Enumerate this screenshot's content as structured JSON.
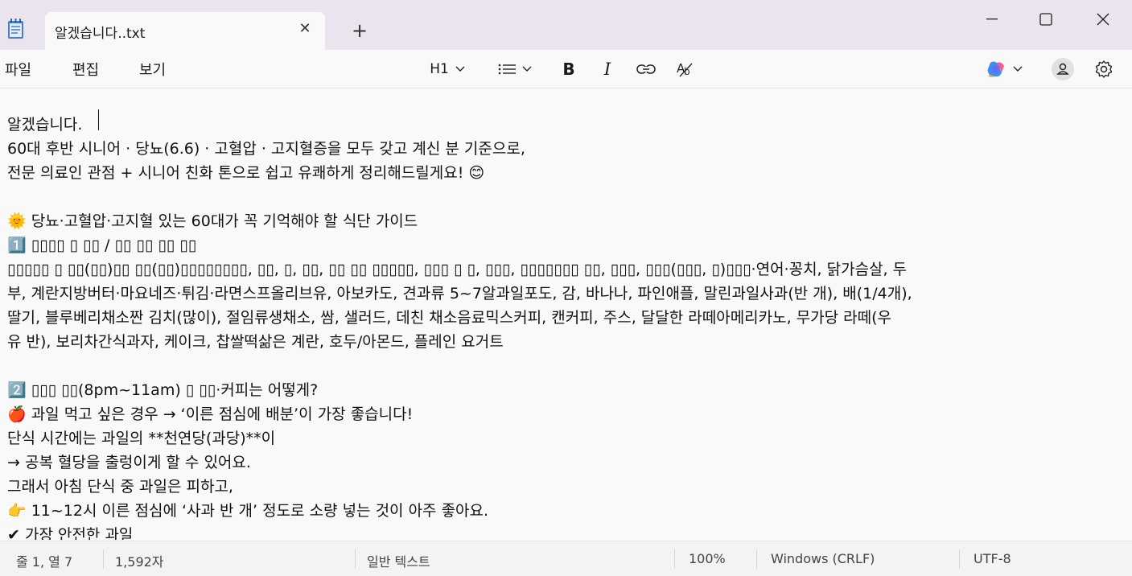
{
  "window": {
    "tab_title": "알겠습니다..txt",
    "icons": {
      "app": "notepad-icon",
      "close_tab": "close-icon",
      "new_tab": "plus-icon",
      "minimize": "minimize-icon",
      "maximize": "maximize-icon",
      "close": "close-icon"
    }
  },
  "menu": {
    "file": "파일",
    "edit": "편집",
    "view": "보기"
  },
  "toolbar": {
    "heading": "H1",
    "icons": [
      "list-icon",
      "bold-icon",
      "italic-icon",
      "link-icon",
      "clear-formatting-icon",
      "copilot-icon",
      "account-icon",
      "settings-icon"
    ]
  },
  "document": {
    "lines": [
      "알겠습니다.",
      "60대 후반 시니어 · 당뇨(6.6) · 고혈압 · 고지혈증을 모두 갖고 계신 분 기준으로,",
      "전문 의료인 관점 + 시니어 친화 톤으로 쉽고 유쾌하게 정리해드릴게요! 😊",
      "",
      "🌞 당뇨·고혈압·고지혈 있는 60대가 꼭 기억해야 할 식단 가이드",
      "1️⃣ ▯▯▯▯ ▯ ▯▯ / ▯▯ ▯▯ ▯▯ ▯▯",
      "▯▯▯▯▯ ▯ ▯▯(▯▯)▯▯ ▯▯(▯▯)▯▯▯▯▯▯▯▯, ▯▯, ▯, ▯▯, ▯▯ ▯▯ ▯▯▯▯▯, ▯▯▯ ▯ ▯, ▯▯▯, ▯▯▯▯▯▯▯ ▯▯, ▯▯▯, ▯▯▯(▯▯▯, ▯)▯▯▯·연어·꽁치, 닭가슴살, 두",
      "부, 계란지방버터·마요네즈·튀김·라면스프올리브유, 아보카도, 견과류 5~7알과일포도, 감, 바나나, 파인애플, 말린과일사과(반 개), 배(1/4개),",
      "딸기, 블루베리채소짠 김치(많이), 절임류생채소, 쌈, 샐러드, 데친 채소음료믹스커피, 캔커피, 주스, 달달한 라떼아메리카노, 무가당 라떼(우",
      "유 반), 보리차간식과자, 케이크, 찹쌀떡삶은 계란, 호두/아몬드, 플레인 요거트",
      "",
      "2️⃣ ▯▯▯ ▯▯(8pm~11am) ▯ ▯▯·커피는 어떻게?",
      "🍎 과일 먹고 싶은 경우 → ‘이른 점심에 배분’이 가장 좋습니다!",
      "단식 시간에는 과일의 **천연당(과당)**이",
      "→ 공복 혈당을 출렁이게 할 수 있어요.",
      "그래서 아침 단식 중 과일은 피하고,",
      "👉 11~12시 이른 점심에 ‘사과 반 개’ 정도로 소량 넣는 것이 아주 좋아요.",
      "✔ 가장 안전한 과일"
    ]
  },
  "status": {
    "position": "줄 1, 열 7",
    "char_count": "1,592자",
    "format": "일반 텍스트",
    "zoom": "100%",
    "line_ending": "Windows (CRLF)",
    "encoding": "UTF-8"
  }
}
